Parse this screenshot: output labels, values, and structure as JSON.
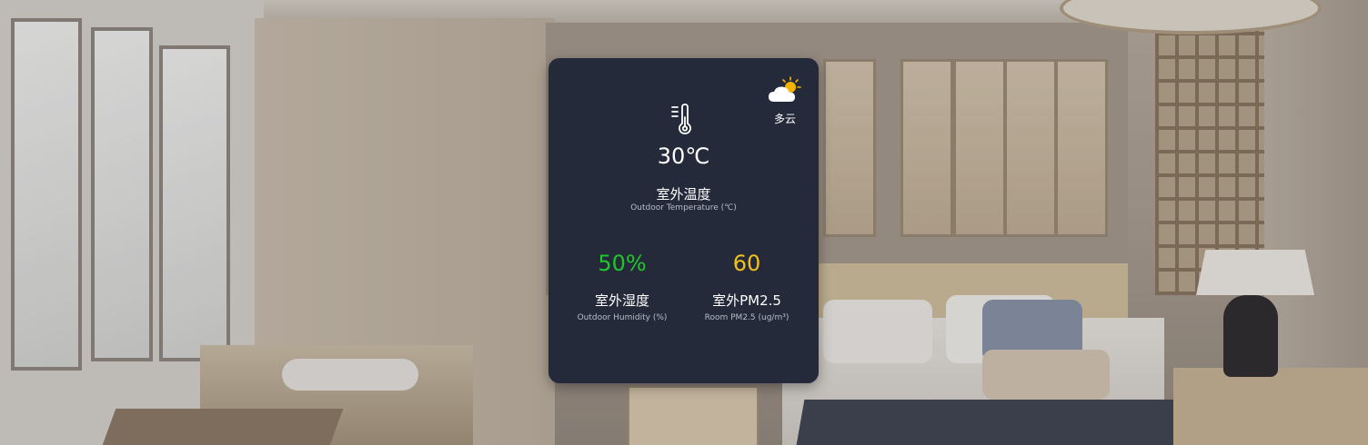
{
  "weather": {
    "condition": "多云",
    "icon": "partly-cloudy-icon"
  },
  "temperature": {
    "icon": "thermometer-icon",
    "value": "30℃",
    "label": "室外温度",
    "sublabel": "Outdoor Temperature (℃)"
  },
  "humidity": {
    "value": "50%",
    "label": "室外湿度",
    "sublabel": "Outdoor Humidity (%)",
    "color": "#1fc52b"
  },
  "pm25": {
    "value": "60",
    "label": "室外PM2.5",
    "sublabel": "Room PM2.5 (ug/m³)",
    "color": "#f2c218"
  },
  "colors": {
    "card_background": "#252a3a",
    "sun": "#f5b400"
  }
}
